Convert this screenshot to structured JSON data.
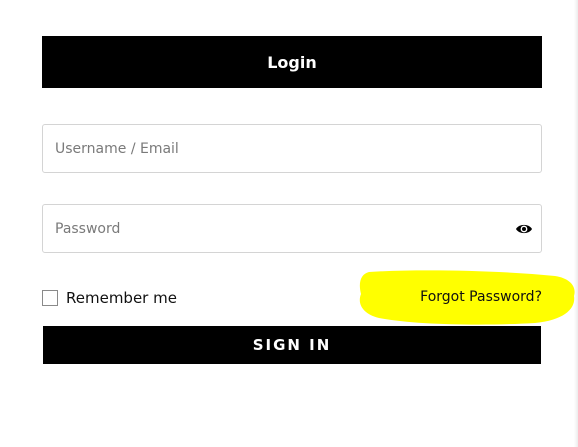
{
  "login": {
    "title": "Login"
  },
  "fields": {
    "username_placeholder": "Username / Email",
    "password_placeholder": "Password",
    "password_toggle_icon": "eye-icon"
  },
  "options": {
    "remember_label": "Remember me",
    "remember_checked": false,
    "forgot_label": "Forgot Password?"
  },
  "actions": {
    "sign_in_label": "SIGN IN"
  },
  "colors": {
    "primary": "#000000",
    "on_primary": "#ffffff",
    "field_border": "#d4d4d4",
    "highlight": "#ffff00"
  }
}
